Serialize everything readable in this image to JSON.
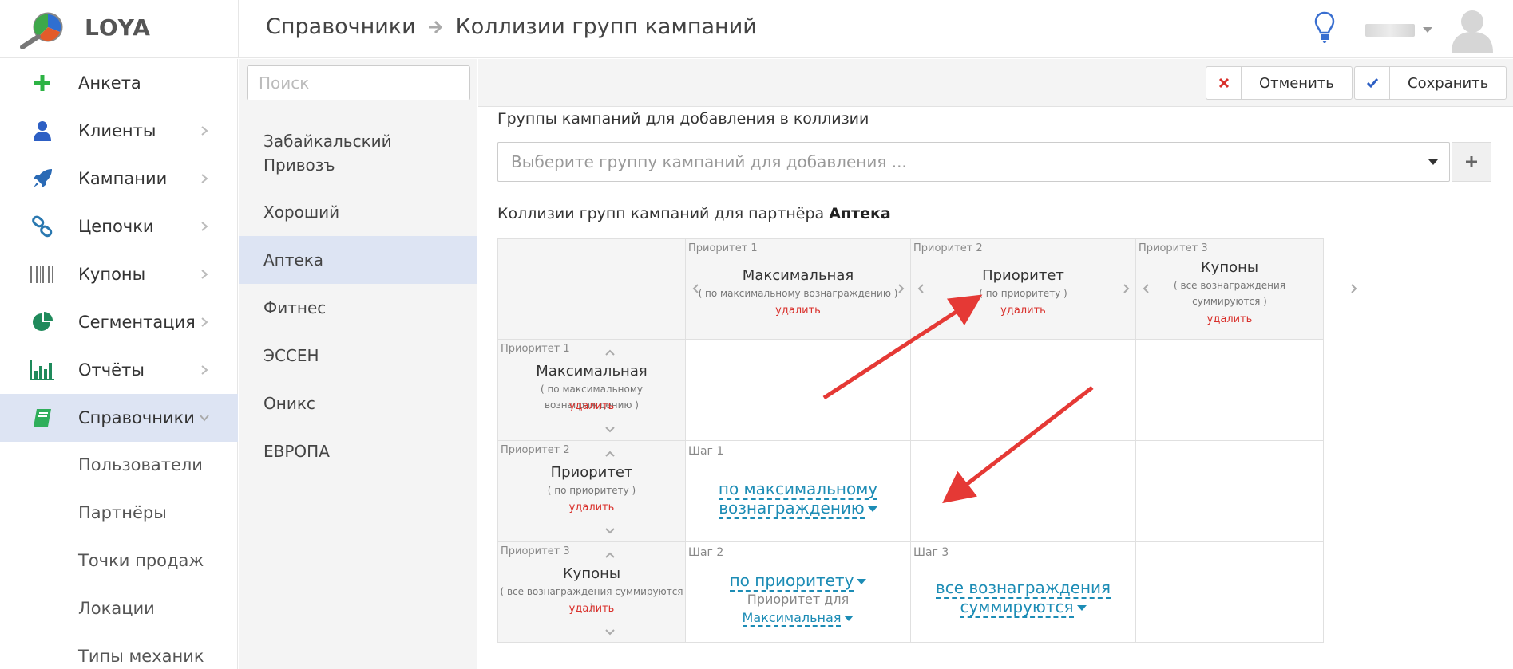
{
  "app": {
    "logo_text": "LOYA"
  },
  "header": {
    "breadcrumb_root": "Справочники",
    "breadcrumb_current": "Коллизии групп кампаний"
  },
  "sidebar": {
    "items": [
      {
        "label": "Анкета",
        "icon": "plus-icon"
      },
      {
        "label": "Клиенты",
        "icon": "user-icon"
      },
      {
        "label": "Кампании",
        "icon": "rocket-icon"
      },
      {
        "label": "Цепочки",
        "icon": "link-icon"
      },
      {
        "label": "Купоны",
        "icon": "barcode-icon"
      },
      {
        "label": "Сегментация",
        "icon": "pie-chart-icon"
      },
      {
        "label": "Отчёты",
        "icon": "bar-chart-icon"
      },
      {
        "label": "Справочники",
        "icon": "book-icon"
      }
    ],
    "subitems": [
      "Пользователи",
      "Партнёры",
      "Точки продаж",
      "Локации",
      "Типы механик"
    ]
  },
  "partners": {
    "search_placeholder": "Поиск",
    "items": [
      {
        "label": "Забайкальский Привозъ"
      },
      {
        "label": "Хороший"
      },
      {
        "label": "Аптека"
      },
      {
        "label": "Фитнес"
      },
      {
        "label": "ЭССЕН"
      },
      {
        "label": "Оникс"
      },
      {
        "label": "ЕВРОПА"
      }
    ]
  },
  "toolbar": {
    "cancel_label": "Отменить",
    "save_label": "Сохранить"
  },
  "main": {
    "add_section_title": "Группы кампаний для добавления в коллизии",
    "select_placeholder": "Выберите группу кампаний для добавления ...",
    "collisions_title": "Коллизии групп кампаний для партнёра",
    "partner_name": "Аптека",
    "groups": [
      {
        "priority": "Приоритет 1",
        "name": "Максимальная",
        "desc": "( по максимальному вознаграждению )",
        "delete": "удалить"
      },
      {
        "priority": "Приоритет 2",
        "name": "Приоритет",
        "desc": "( по приоритету )",
        "delete": "удалить"
      },
      {
        "priority": "Приоритет 3",
        "name": "Купоны",
        "desc": "( все вознаграждения суммируются )",
        "delete": "удалить"
      }
    ],
    "cells": {
      "r2c1_step": "Шаг 1",
      "r2c1_line1": "по максимальному",
      "r2c1_line2": "вознаграждению",
      "r3c1_step": "Шаг 2",
      "r3c1_link": "по приоритету",
      "r3c1_note": "Приоритет для",
      "r3c1_sublink": "Максимальная",
      "r3c2_step": "Шаг 3",
      "r3c2_line1": "все вознаграждения",
      "r3c2_line2": "суммируются"
    }
  },
  "colors": {
    "accent_blue": "#1c8cb5",
    "active_bg": "#dde4f3",
    "delete_red": "#d9312c",
    "annotation_red": "#e53935"
  }
}
